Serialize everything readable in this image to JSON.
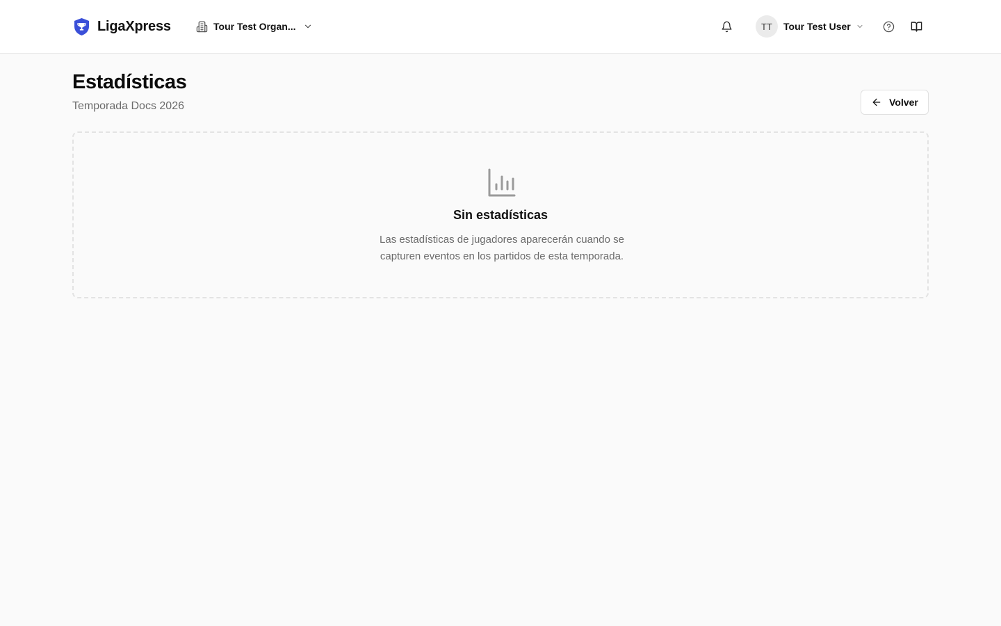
{
  "header": {
    "brand_name": "LigaXpress",
    "brand_color": "#3a4fd8",
    "org_name": "Tour Test Organ...",
    "user_initials": "TT",
    "user_name": "Tour Test User",
    "icons": {
      "logo": "shield-trophy-icon",
      "org": "building-icon",
      "notifications": "bell-icon",
      "help": "help-circle-icon",
      "docs": "book-open-icon"
    }
  },
  "page": {
    "title": "Estadísticas",
    "subtitle": "Temporada Docs 2026",
    "back_label": "Volver",
    "back_icon": "arrow-left-icon"
  },
  "empty_state": {
    "icon": "bar-chart-icon",
    "title": "Sin estadísticas",
    "description": "Las estadísticas de jugadores aparecerán cuando se capturen eventos en los partidos de esta temporada."
  }
}
